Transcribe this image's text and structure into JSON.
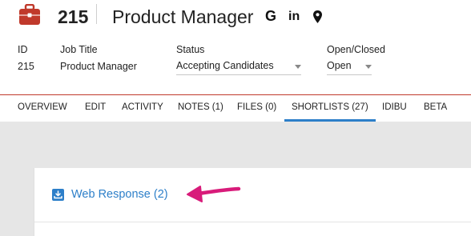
{
  "header": {
    "job_id": "215",
    "job_title": "Product Manager",
    "icons": [
      "google-icon",
      "linkedin-icon",
      "location-pin-icon"
    ],
    "google_glyph": "G",
    "linkedin_glyph": "in"
  },
  "fields": {
    "id": {
      "label": "ID",
      "value": "215"
    },
    "job_title": {
      "label": "Job Title",
      "value": "Product Manager"
    },
    "status": {
      "label": "Status",
      "value": "Accepting Candidates"
    },
    "open_closed": {
      "label": "Open/Closed",
      "value": "Open"
    }
  },
  "tabs": [
    {
      "label": "OVERVIEW"
    },
    {
      "label": "EDIT"
    },
    {
      "label": "ACTIVITY"
    },
    {
      "label": "NOTES (1)"
    },
    {
      "label": "FILES (0)"
    },
    {
      "label": "SHORTLISTS (27)"
    },
    {
      "label": "IDIBU"
    },
    {
      "label": "BETA"
    }
  ],
  "active_tab": "SHORTLISTS (27)",
  "shortlist": {
    "web_response_label": "Web Response (2)"
  },
  "colors": {
    "brand": "#c0392b",
    "link": "#2d7fc9",
    "annotation_arrow": "#d81b7a"
  }
}
